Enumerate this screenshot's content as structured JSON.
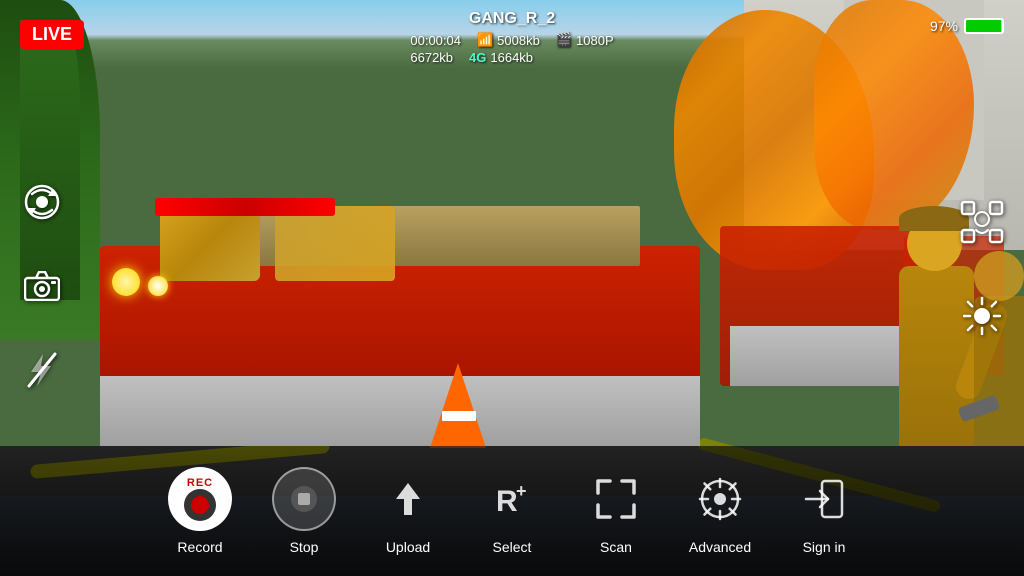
{
  "status": {
    "live_label": "LIVE",
    "device_name": "GANG_R_2",
    "time": "00:00:04",
    "wifi_speed": "5008kb",
    "resolution_icon": "film-icon",
    "resolution": "1080P",
    "data_used": "6672kb",
    "network_type": "4G",
    "network_speed": "1664kb",
    "battery_pct": "97%",
    "battery_fill_pct": 97
  },
  "left_icons": [
    {
      "id": "rotate-camera-icon",
      "symbol": "↻"
    },
    {
      "id": "photo-icon",
      "symbol": "📷"
    },
    {
      "id": "flash-off-icon",
      "symbol": "⚡"
    }
  ],
  "right_icons": [
    {
      "id": "person-icon",
      "symbol": "👤"
    },
    {
      "id": "brightness-icon",
      "symbol": "☀"
    }
  ],
  "toolbar": {
    "items": [
      {
        "id": "record-button",
        "label": "Record",
        "type": "record"
      },
      {
        "id": "stop-button",
        "label": "Stop",
        "type": "stop"
      },
      {
        "id": "upload-button",
        "label": "Upload",
        "type": "upload"
      },
      {
        "id": "select-button",
        "label": "Select",
        "type": "select"
      },
      {
        "id": "scan-button",
        "label": "Scan",
        "type": "scan"
      },
      {
        "id": "advanced-button",
        "label": "Advanced",
        "type": "advanced"
      },
      {
        "id": "signin-button",
        "label": "Sign in",
        "type": "signin"
      }
    ]
  }
}
